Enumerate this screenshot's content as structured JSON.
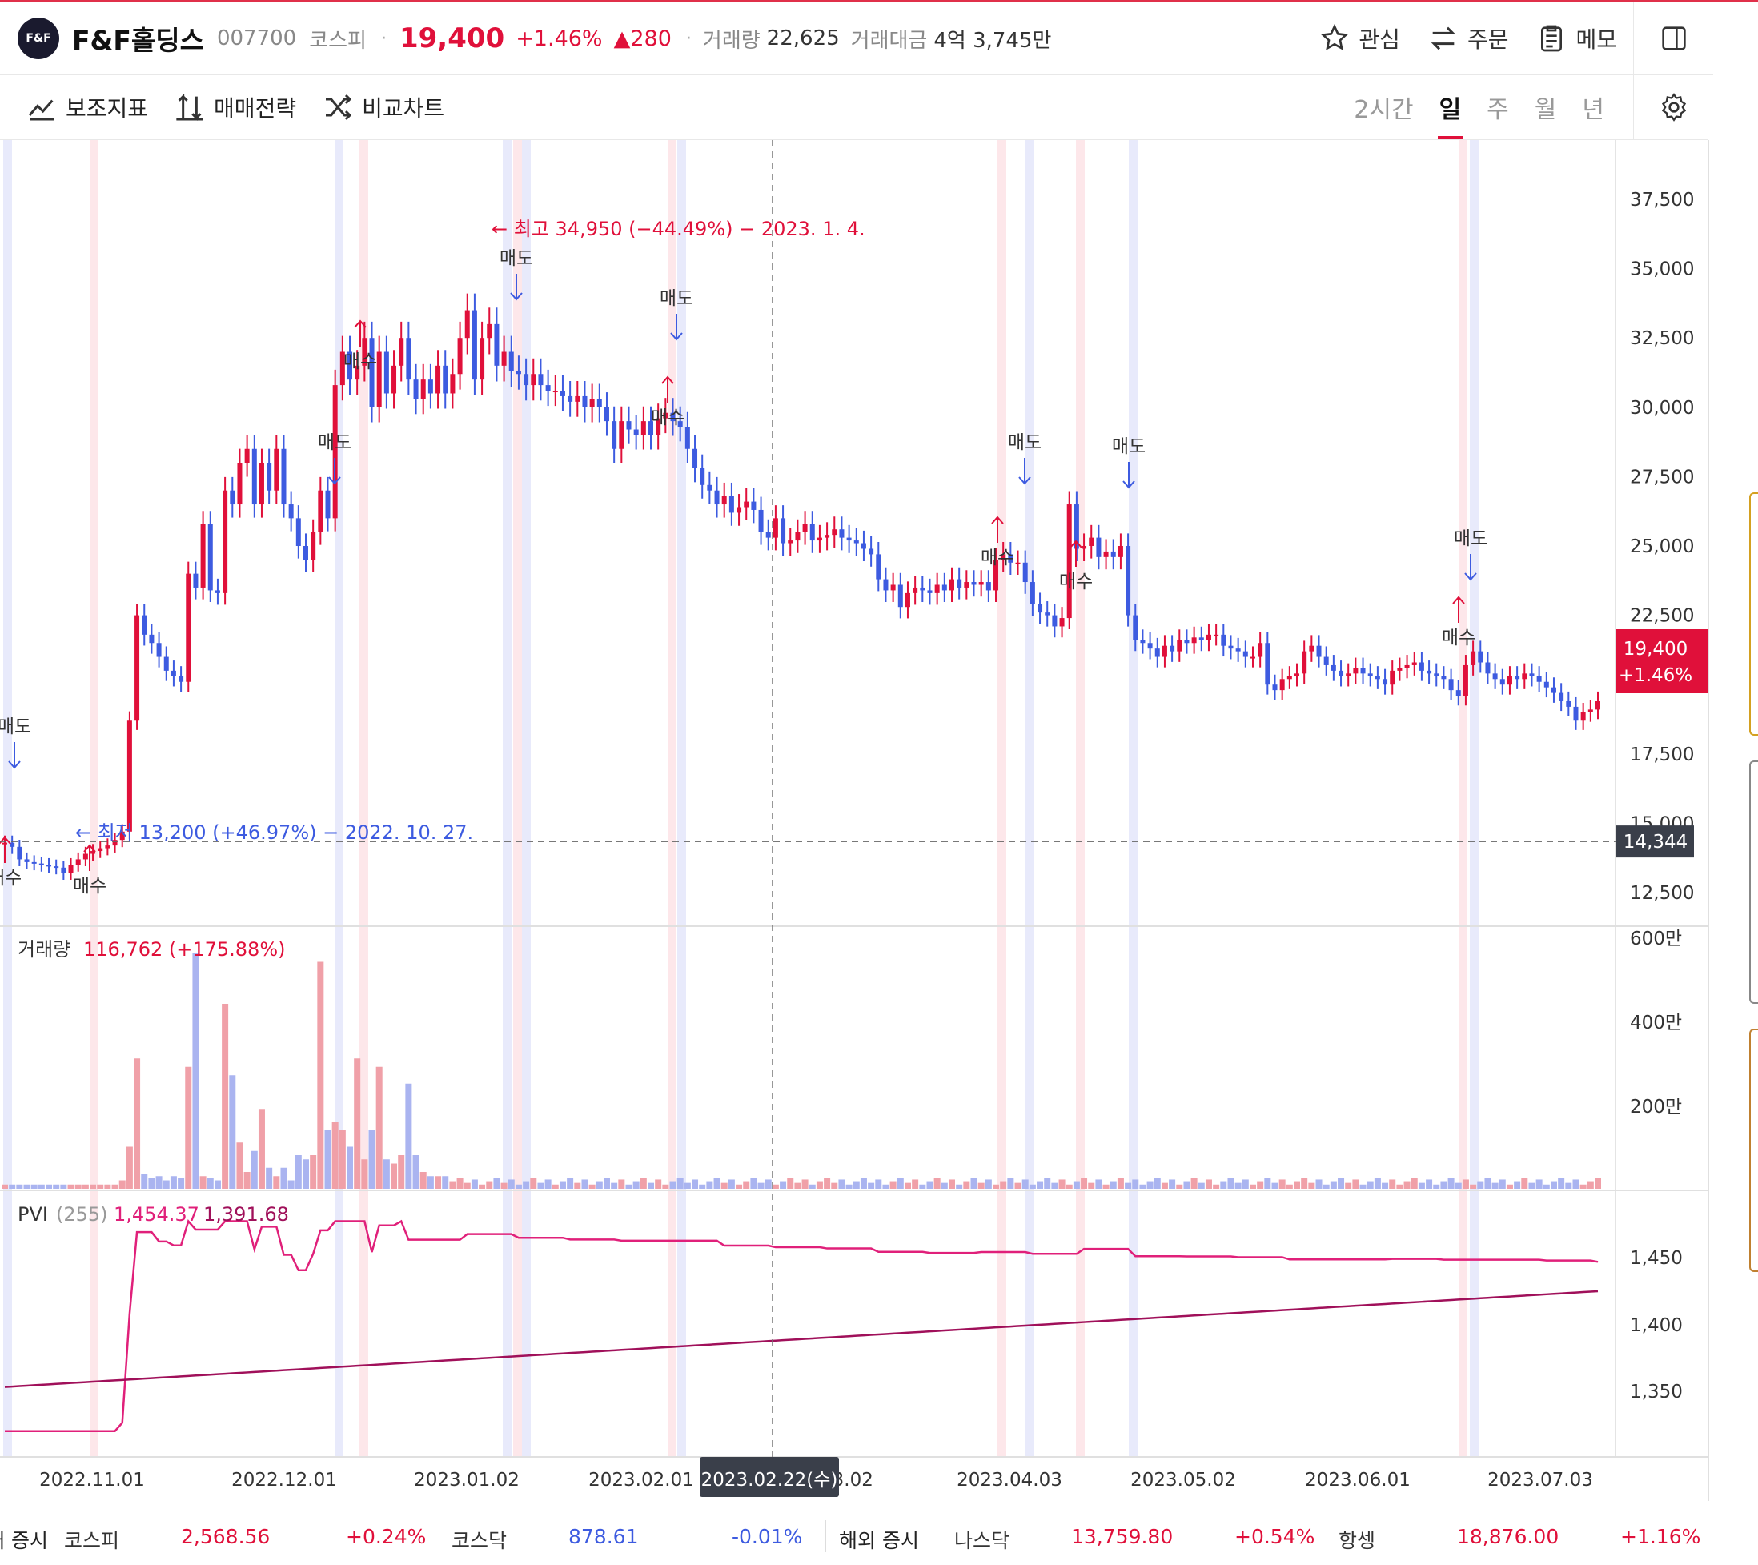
{
  "header": {
    "logo_text": "F&F",
    "stock_name": "F&F홀딩스",
    "code": "007700",
    "market": "코스피",
    "price": "19,400",
    "change_pct": "+1.46%",
    "change_abs": "▲280",
    "volume_label": "거래량",
    "volume": "22,625",
    "amount_label": "거래대금",
    "amount": "4억 3,745만",
    "buttons": [
      "관심",
      "주문",
      "메모"
    ]
  },
  "toolbar": {
    "indicators": "보조지표",
    "strategy": "매매전략",
    "compare": "비교차트",
    "periods": [
      "2시간",
      "일",
      "주",
      "월",
      "년"
    ],
    "active_period": "일"
  },
  "chart_data": {
    "type": "candlestick",
    "price_axis": [
      "37,500",
      "35,000",
      "32,500",
      "30,000",
      "27,500",
      "25,000",
      "22,500",
      "20,000",
      "17,500",
      "15,000",
      "12,500"
    ],
    "price_ylim": [
      11300,
      37900
    ],
    "date_labels": [
      "2022.11.01",
      "2022.12.01",
      "2023.01.02",
      "2023.02.01",
      "2023.03.02",
      "2023.04.03",
      "2023.05.02",
      "2023.06.01",
      "2023.07.03"
    ],
    "crosshair_date": "2023.02.22(수)",
    "current_price_tag": "19,400",
    "current_change_tag": "+1.46%",
    "reference_price_tag": "14,344",
    "reference_price": 14344,
    "high_annotation": "최고 34,950 (−44.49%) − 2023. 1. 4.",
    "low_annotation": "최저 13,200 (+46.97%) − 2022. 10. 27.",
    "buy_label": "매수",
    "sell_label": "매도",
    "closes": [
      14300,
      14150,
      13700,
      13600,
      13550,
      13500,
      13450,
      13400,
      13200,
      13500,
      13700,
      13900,
      14000,
      14100,
      14200,
      14400,
      14700,
      18700,
      22500,
      21800,
      21500,
      21000,
      20500,
      20300,
      20100,
      24000,
      23500,
      25800,
      23400,
      23300,
      27000,
      26500,
      28000,
      28500,
      26500,
      28000,
      27000,
      28500,
      26500,
      26000,
      25000,
      24500,
      25500,
      27000,
      26000,
      30800,
      32000,
      31000,
      31500,
      32500,
      30000,
      32000,
      30500,
      31500,
      32500,
      31000,
      30300,
      31000,
      30500,
      31500,
      30500,
      31200,
      32500,
      33500,
      31000,
      32500,
      33000,
      31500,
      32000,
      31300,
      31200,
      30800,
      31200,
      30800,
      30600,
      30600,
      30400,
      30200,
      30400,
      30000,
      30300,
      30000,
      29500,
      28500,
      29500,
      29200,
      29000,
      29500,
      29000,
      29600,
      29800,
      29500,
      29300,
      28500,
      27800,
      27200,
      27000,
      26500,
      26800,
      26200,
      26400,
      26600,
      26300,
      25500,
      25300,
      26000,
      25100,
      25200,
      25500,
      25800,
      25200,
      25300,
      25400,
      25600,
      25300,
      25200,
      25100,
      24900,
      24700,
      23800,
      23400,
      23600,
      22800,
      23300,
      23500,
      23400,
      23300,
      23600,
      23400,
      23800,
      23500,
      23700,
      23600,
      23700,
      23400,
      24500,
      24700,
      24400,
      24400,
      23700,
      22900,
      22600,
      22500,
      22100,
      22400,
      26500,
      24900,
      25000,
      25300,
      24600,
      24800,
      24600,
      25000,
      22500,
      21600,
      21500,
      21300,
      21000,
      21400,
      21200,
      21600,
      21500,
      21700,
      21600,
      21800,
      21800,
      21400,
      21300,
      21200,
      21000,
      21000,
      21500,
      20000,
      19800,
      20200,
      20300,
      20400,
      21200,
      21400,
      21000,
      20700,
      20500,
      20300,
      20400,
      20600,
      20400,
      20300,
      20200,
      20000,
      20500,
      20600,
      20700,
      20800,
      20500,
      20400,
      20300,
      20200,
      19800,
      19600,
      20700,
      21200,
      20800,
      20400,
      20200,
      20000,
      20300,
      20200,
      20400,
      20300,
      20100,
      19900,
      19700,
      19400,
      19200,
      18700,
      19000,
      19100,
      19400
    ],
    "volume_label": "거래량",
    "volume_value": "116,762 (+175.88%)",
    "volume_axis": [
      "600만",
      "400만",
      "200만"
    ],
    "volume_spikes_million": [
      0.1,
      0.1,
      0.1,
      0.1,
      0.1,
      0.1,
      0.1,
      0.1,
      0.1,
      0.1,
      0.1,
      0.1,
      0.1,
      0.1,
      0.1,
      0.1,
      0.2,
      1.0,
      3.1,
      0.35,
      0.25,
      0.3,
      0.2,
      0.3,
      0.25,
      2.9,
      5.6,
      0.3,
      0.25,
      0.2,
      4.4,
      2.7,
      1.1,
      0.4,
      0.9,
      1.9,
      0.5,
      0.3,
      0.5,
      0.2,
      0.8,
      0.7,
      0.8,
      5.4,
      1.4,
      1.6,
      1.4,
      1.0,
      3.1,
      0.7,
      1.4,
      2.9,
      0.7,
      0.6,
      0.8,
      2.5,
      0.8,
      0.4,
      0.3,
      0.3,
      0.3
    ],
    "pvi_label": "PVI",
    "pvi_period": "(255)",
    "pvi_value": "1,454.37",
    "pvi_signal": "1,391.68",
    "pvi_axis": [
      "1,450",
      "1,400",
      "1,350"
    ]
  },
  "bottom_ticker": {
    "domestic_label": "국내 증시",
    "kospi_label": "코스피",
    "kospi_value": "2,568.56",
    "kospi_change": "+0.24%",
    "kosdaq_label": "코스닥",
    "kosdaq_value": "878.61",
    "kosdaq_change": "-0.01%",
    "foreign_label": "해외 증시",
    "nasdaq_label": "나스닥",
    "nasdaq_value": "13,759.80",
    "nasdaq_change": "+0.54%",
    "hangseng_label": "항셍",
    "hangseng_value": "18,876.00",
    "hangseng_change": "+1.16%"
  },
  "colors": {
    "up": "#e0103a",
    "down": "#3d5be0",
    "pvi_line": "#e0207a",
    "pvi_signal": "#a0105a"
  }
}
